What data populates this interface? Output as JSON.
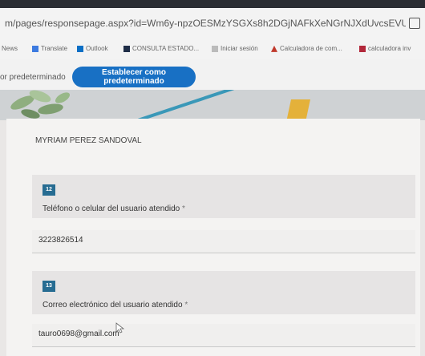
{
  "browser": {
    "url": "m/pages/responsepage.aspx?id=Wm6y-npzOESMzYSGXs8h2DGjNAFkXeNGrNJXdUvcsEVUMFpUUUtOMDI0N0h...",
    "bookmarks": [
      {
        "label": "News"
      },
      {
        "label": "Translate"
      },
      {
        "label": "Outlook"
      },
      {
        "label": "CONSULTA ESTADO..."
      },
      {
        "label": "Iniciar sesión"
      },
      {
        "label": "Calculadora de com..."
      },
      {
        "label": "calculadora inv"
      }
    ]
  },
  "infobar": {
    "text": "or predeterminado",
    "button_label": "Establecer como predeterminado"
  },
  "form": {
    "previous_answer": "MYRIAM PEREZ SANDOVAL",
    "questions": [
      {
        "number": "12",
        "label": "Teléfono o celular del usuario atendido",
        "required": " *",
        "answer": "3223826514"
      },
      {
        "number": "13",
        "label": "Correo electrónico del usuario atendido",
        "required": " *",
        "answer": "tauro0698@gmail.com"
      }
    ]
  },
  "colors": {
    "accent_button": "#1870c4",
    "question_badge": "#276c92",
    "banner_yellow": "#e4b13a"
  }
}
